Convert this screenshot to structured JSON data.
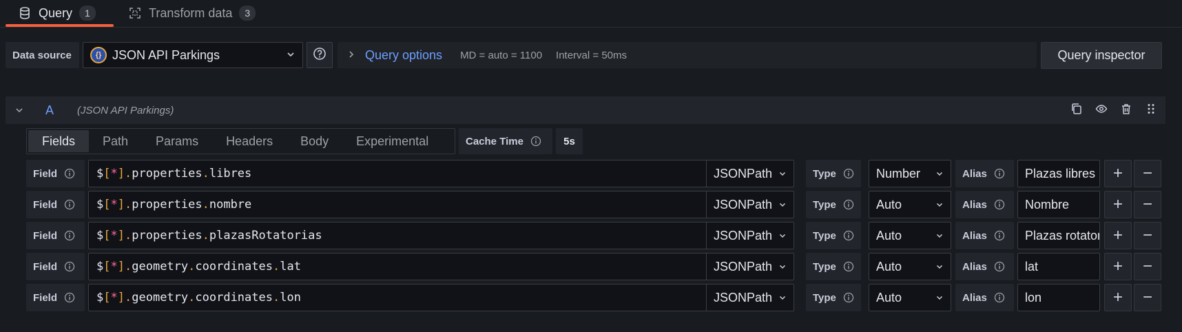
{
  "tabs": [
    {
      "label": "Query",
      "count": "1",
      "icon": "database-icon"
    },
    {
      "label": "Transform data",
      "count": "3",
      "icon": "transform-icon"
    }
  ],
  "toolbar": {
    "datasource_label": "Data source",
    "datasource_value": "JSON API Parkings",
    "query_options_label": "Query options",
    "md": "MD = auto = 1100",
    "interval": "Interval = 50ms",
    "query_inspector": "Query inspector"
  },
  "query": {
    "letter": "A",
    "datasource": "(JSON API Parkings)"
  },
  "subtabs": [
    "Fields",
    "Path",
    "Params",
    "Headers",
    "Body",
    "Experimental"
  ],
  "cache": {
    "label": "Cache Time",
    "value": "5s"
  },
  "labels": {
    "field": "Field",
    "type": "Type",
    "alias": "Alias"
  },
  "plus_symbol": "+",
  "minus_symbol": "−",
  "fields": [
    {
      "path": [
        "$",
        "[",
        "*",
        "]",
        ".",
        "properties",
        ".",
        "libres"
      ],
      "language": "JSONPath",
      "type": "Number",
      "alias": "Plazas libres"
    },
    {
      "path": [
        "$",
        "[",
        "*",
        "]",
        ".",
        "properties",
        ".",
        "nombre"
      ],
      "language": "JSONPath",
      "type": "Auto",
      "alias": "Nombre"
    },
    {
      "path": [
        "$",
        "[",
        "*",
        "]",
        ".",
        "properties",
        ".",
        "plazasRotatorias"
      ],
      "language": "JSONPath",
      "type": "Auto",
      "alias": "Plazas rotatorias"
    },
    {
      "path": [
        "$",
        "[",
        "*",
        "]",
        ".",
        "geometry",
        ".",
        "coordinates",
        ".",
        "lat"
      ],
      "language": "JSONPath",
      "type": "Auto",
      "alias": "lat"
    },
    {
      "path": [
        "$",
        "[",
        "*",
        "]",
        ".",
        "geometry",
        ".",
        "coordinates",
        ".",
        "lon"
      ],
      "language": "JSONPath",
      "type": "Auto",
      "alias": "lon"
    }
  ],
  "colors": {
    "accent_blue": "#6e9fff",
    "tab_underline": "#f55f3e",
    "bracket": "#e8a83a",
    "star": "#ff6a9a"
  }
}
